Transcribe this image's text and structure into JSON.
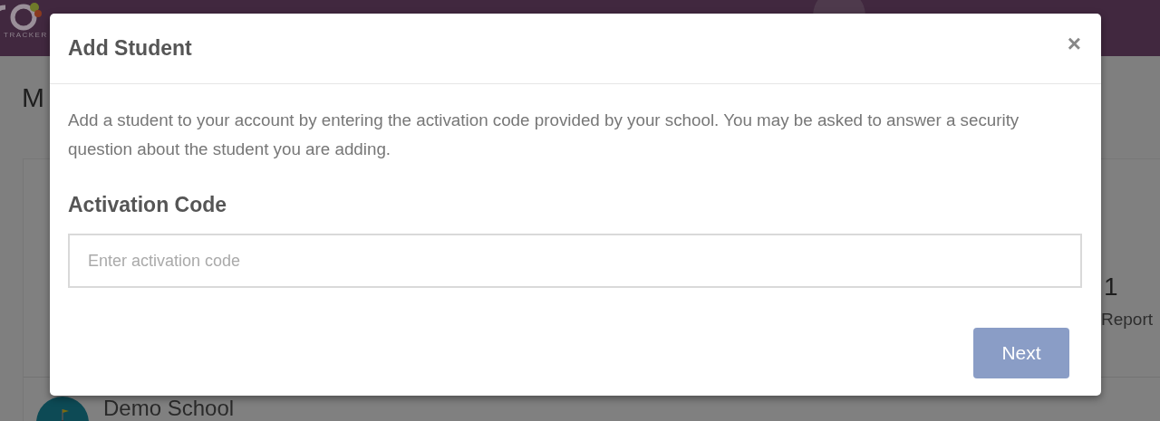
{
  "header": {
    "logo_caption": "TRACKER"
  },
  "page": {
    "title": "M",
    "stat": {
      "value": "1",
      "label": "Report"
    },
    "school": {
      "name": "Demo School"
    }
  },
  "modal": {
    "title": "Add Student",
    "close": "×",
    "description": "Add a student to your account by entering the activation code provided by your school. You may be asked to answer a security question about the student you are adding.",
    "field_label": "Activation Code",
    "field": {
      "placeholder": "Enter activation code"
    },
    "next_button": {
      "label": "Next",
      "disabled": true
    }
  }
}
